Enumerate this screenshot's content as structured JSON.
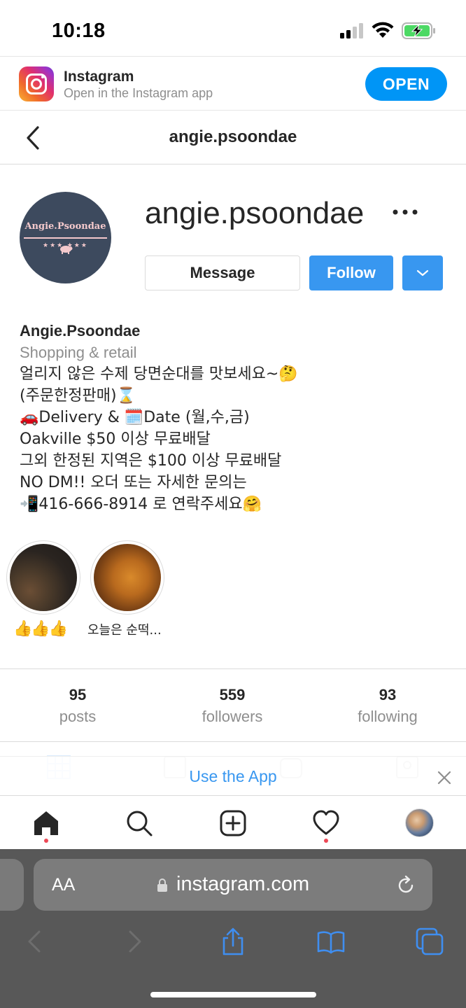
{
  "status_bar": {
    "time": "10:18"
  },
  "app_banner": {
    "title": "Instagram",
    "subtitle": "Open in the Instagram app",
    "open_label": "OPEN"
  },
  "nav_header": {
    "title": "angie.psoondae"
  },
  "profile": {
    "username": "angie.psoondae",
    "avatar_text": "Angie.Psoondae",
    "avatar_stars": "★★★      ★★★",
    "message_label": "Message",
    "follow_label": "Follow"
  },
  "bio": {
    "name": "Angie.Psoondae",
    "category": "Shopping & retail",
    "lines": [
      "얼리지 않은 수제 당면순대를 맛보세요~🤔",
      "(주문한정판매)⌛",
      "🚗Delivery & 🗓️Date (월,수,금)",
      "Oakville $50 이상 무료배달",
      "그외 한정된 지역은 $100 이상 무료배달",
      "NO DM!! 오더 또는 자세한 문의는",
      "📲416-666-8914 로 연락주세요🤗"
    ]
  },
  "highlights": [
    {
      "label": "👍👍👍"
    },
    {
      "label": "오늘은 순떡..."
    }
  ],
  "stats": {
    "posts_count": "95",
    "posts_label": "posts",
    "followers_count": "559",
    "followers_label": "followers",
    "following_count": "93",
    "following_label": "following"
  },
  "use_app": {
    "label": "Use the App"
  },
  "safari": {
    "aa_label": "AA",
    "url": "instagram.com"
  },
  "colors": {
    "accent": "#3897f0",
    "open_button": "#0095f6",
    "notification_dot": "#ed4956",
    "safari_toolbar": "#585858"
  }
}
